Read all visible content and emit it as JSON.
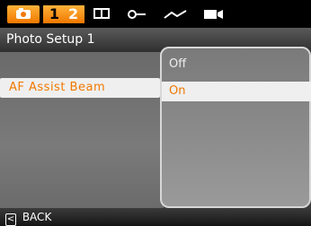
{
  "tabs": {
    "photo_icon": "camera-icon",
    "page_numbers": [
      "1",
      "2"
    ],
    "icons": [
      "playback-icon",
      "key-icon",
      "line-icon",
      "movie-icon"
    ]
  },
  "header": {
    "title": "Photo Setup 1"
  },
  "menu": {
    "items": [
      {
        "label": "AF Assist Beam",
        "selected": true
      }
    ]
  },
  "options": {
    "items": [
      {
        "label": "Off",
        "selected": false
      },
      {
        "label": "On",
        "selected": true
      }
    ]
  },
  "footer": {
    "back_label": "BACK",
    "back_key": "<"
  },
  "colors": {
    "accent": "#f07800",
    "highlight": "#efefef"
  }
}
